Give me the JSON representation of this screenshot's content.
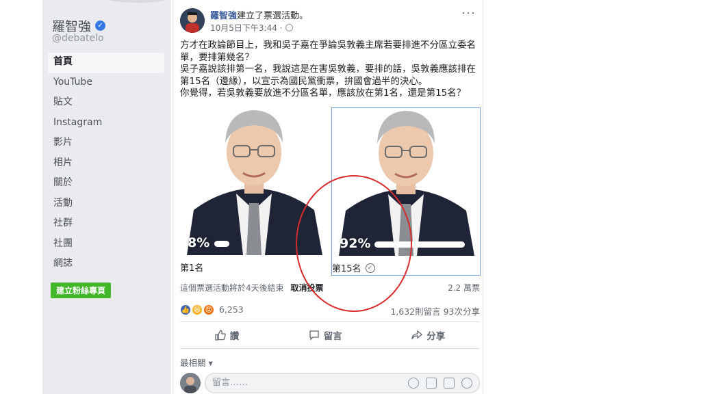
{
  "sidebar": {
    "page_name": "羅智強",
    "handle": "@debatelo",
    "items": [
      {
        "label": "首頁",
        "active": true
      },
      {
        "label": "YouTube"
      },
      {
        "label": "貼文"
      },
      {
        "label": "Instagram"
      },
      {
        "label": "影片"
      },
      {
        "label": "相片"
      },
      {
        "label": "關於"
      },
      {
        "label": "活動"
      },
      {
        "label": "社群"
      },
      {
        "label": "社團"
      },
      {
        "label": "網誌"
      }
    ],
    "create_page_label": "建立粉絲專頁"
  },
  "post": {
    "author": "羅智強",
    "action": "建立了票選活動。",
    "timestamp": "10月5日下午3:44 ·",
    "more": "···",
    "body": [
      "方才在政論節目上，我和吳子嘉在爭論吳敦義主席若要排進不分區立委名單，要排第幾名？",
      "吳子嘉說該排第一名，我說這是在害吳敦義，要排的話，吳敦義應該排在第15名（邊緣），以宣示為國民黨衝票，拚國會過半的決心。",
      "你覺得，若吳敦義要放進不分區名單，應該放在第1名，還是第15名？"
    ]
  },
  "poll": {
    "options": [
      {
        "label": "第1名",
        "percent": "8%",
        "fraction": 0.08,
        "selected": false
      },
      {
        "label": "第15名",
        "percent": "92%",
        "fraction": 0.92,
        "selected": true
      }
    ],
    "ends_text": "這個票選活動將於4天後結束",
    "cancel_label": "取消投票",
    "votes": "2.2 萬票"
  },
  "engagement": {
    "reactions_count": "6,253",
    "comments": "1,632則留言",
    "shares": "93次分享"
  },
  "actions": {
    "like": "讚",
    "comment": "留言",
    "share": "分享"
  },
  "comments_section": {
    "sort_label": "最相關 ▾",
    "placeholder": "留言……"
  },
  "colors": {
    "link": "#365899",
    "highlight_circle": "#d82b2b",
    "create_button": "#42b72a"
  }
}
